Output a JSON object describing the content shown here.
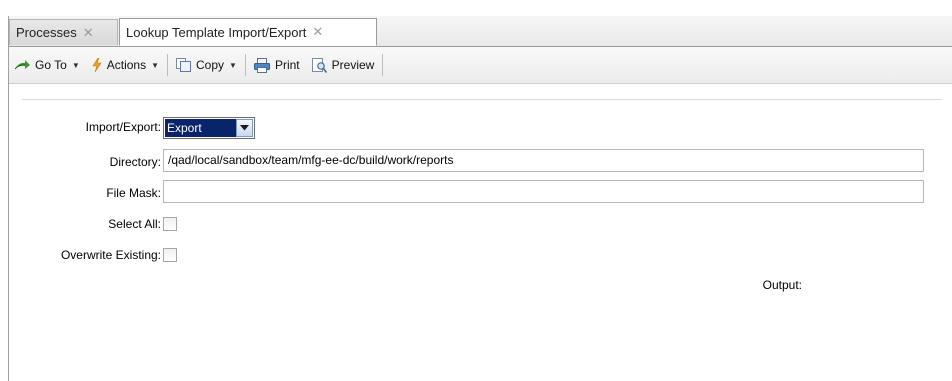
{
  "tabs": [
    {
      "label": "Processes",
      "active": false,
      "close_glyph": "✕"
    },
    {
      "label": "Lookup Template Import/Export",
      "active": true,
      "close_glyph": "✕"
    }
  ],
  "toolbar": {
    "goto_label": "Go To",
    "actions_label": "Actions",
    "copy_label": "Copy",
    "print_label": "Print",
    "preview_label": "Preview"
  },
  "form": {
    "import_export_label": "Import/Export:",
    "import_export_value": "Export",
    "directory_label": "Directory:",
    "directory_value": "/qad/local/sandbox/team/mfg-ee-dc/build/work/reports",
    "file_mask_label": "File Mask:",
    "file_mask_value": "",
    "select_all_label": "Select All:",
    "select_all_checked": false,
    "overwrite_label": "Overwrite Existing:",
    "overwrite_checked": false,
    "output_label": "Output:"
  },
  "colors": {
    "selection": "#0a246a",
    "goto_icon": "#3a9a2c",
    "actions_icon": "#f0a020",
    "print_icon": "#2e6fb5"
  },
  "icons": [
    "go-to-arrow-icon",
    "lightning-icon",
    "copy-icon",
    "printer-icon",
    "preview-icon",
    "dropdown-arrow-icon",
    "close-icon"
  ]
}
